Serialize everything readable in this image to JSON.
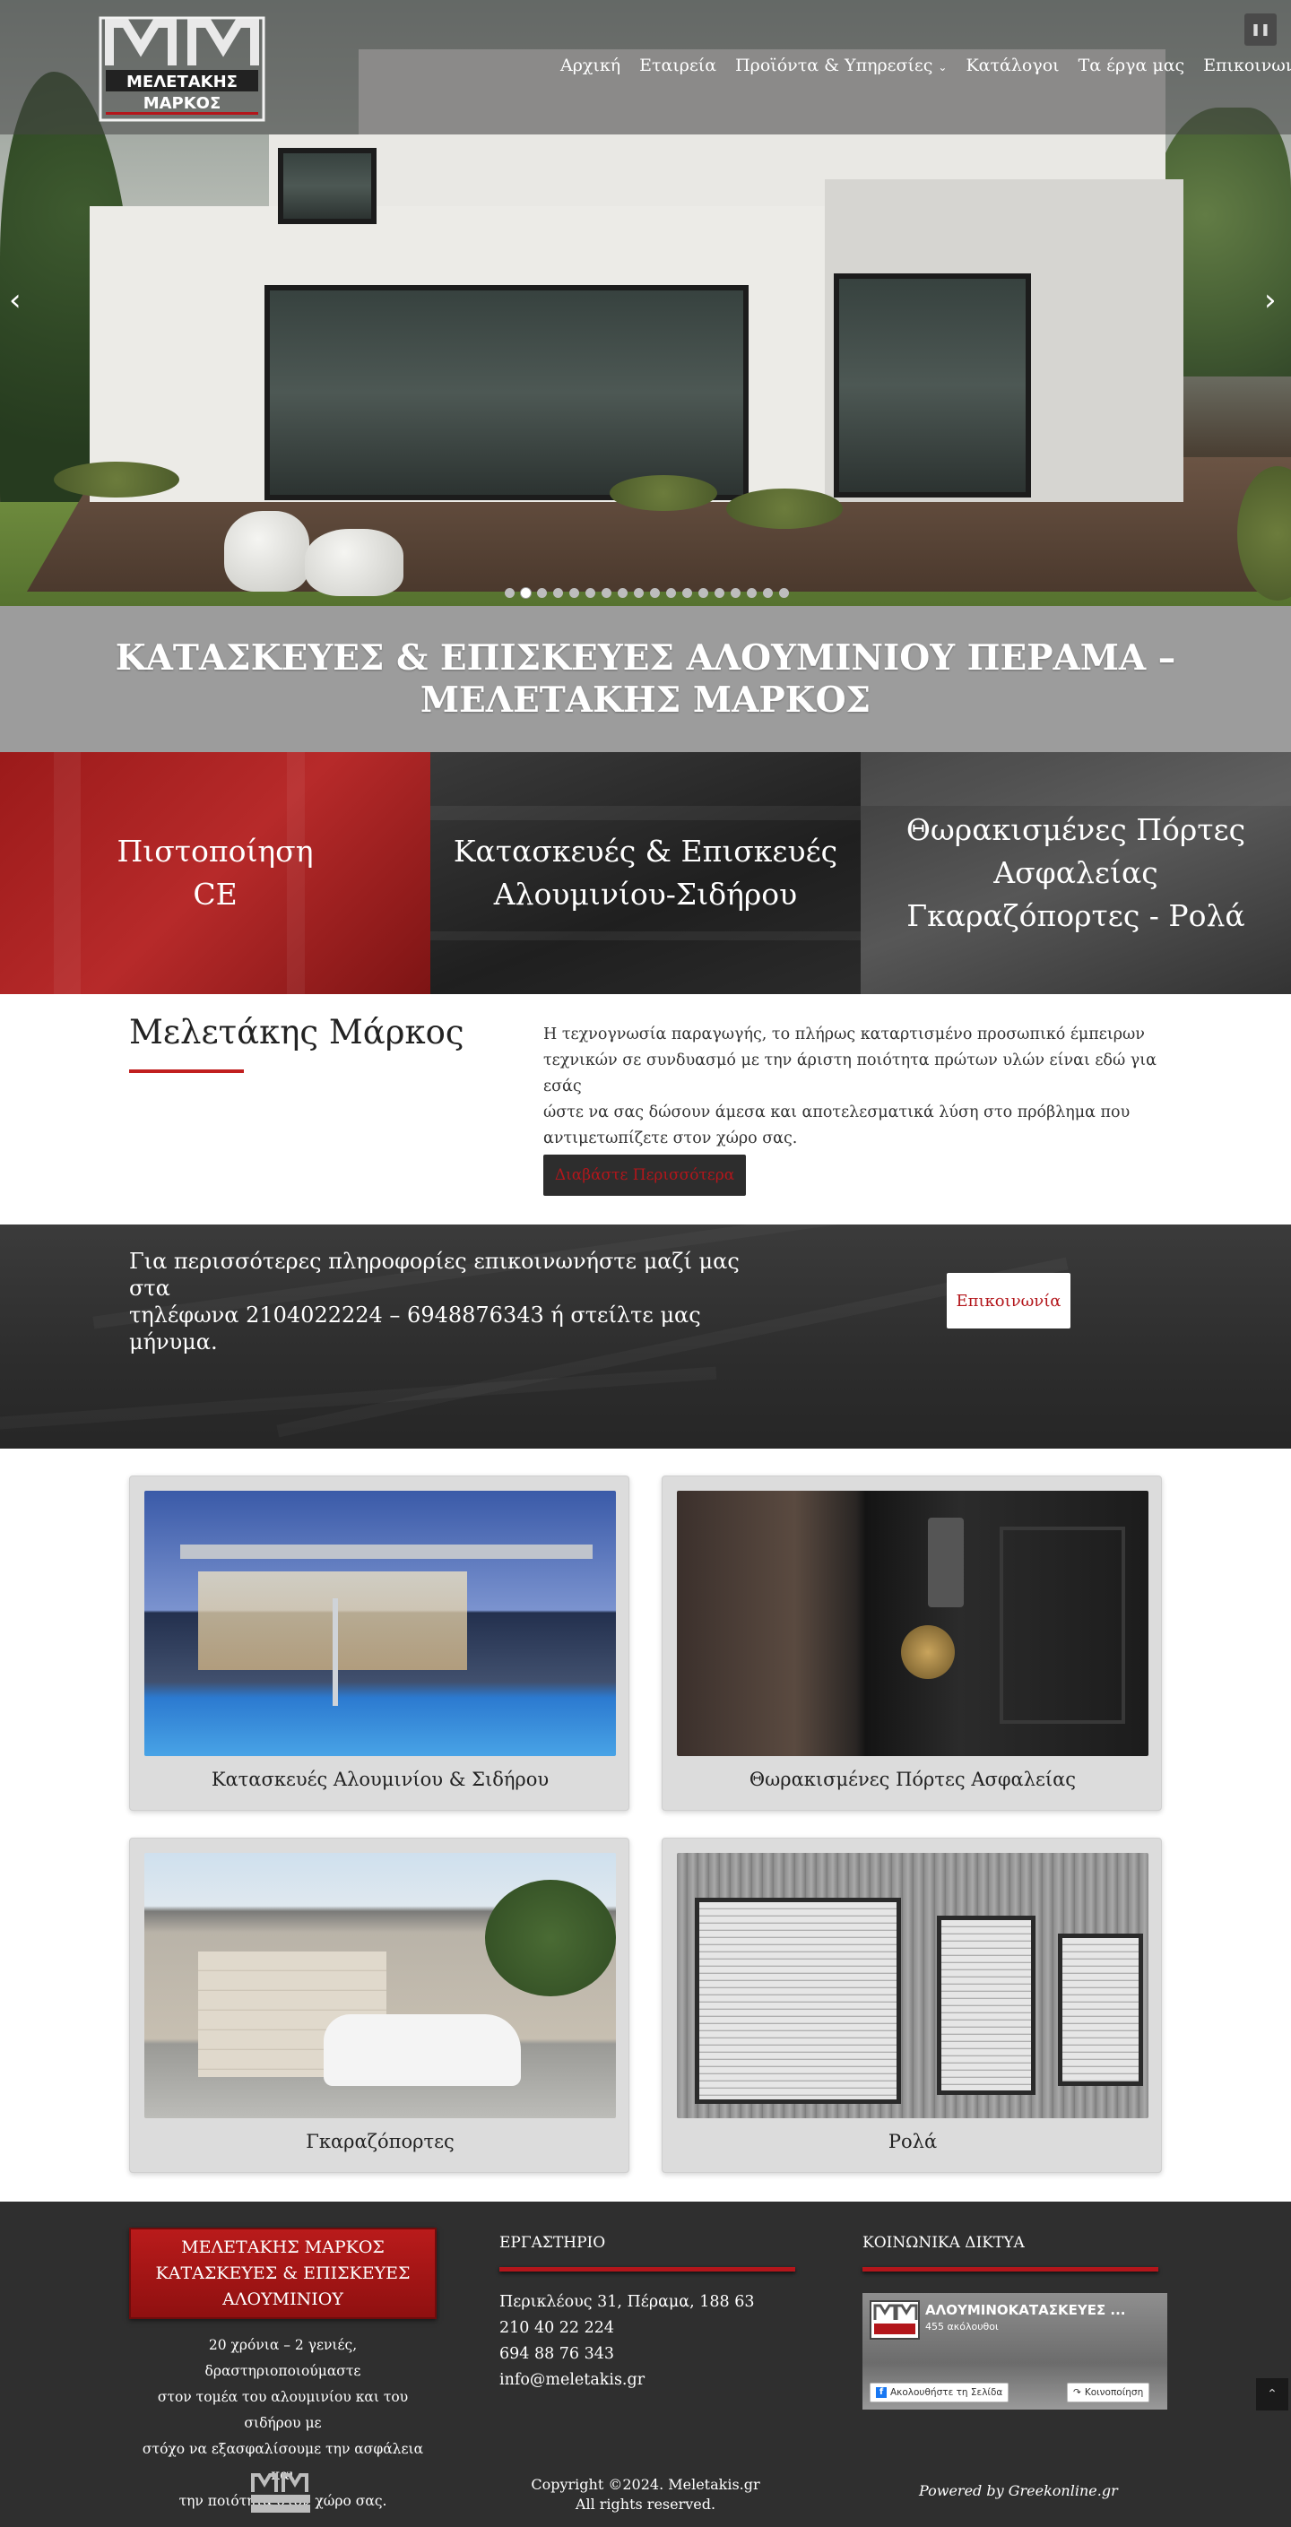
{
  "header": {
    "logo": {
      "line1": "ΜΕΛΕΤΑΚΗΣ",
      "line2": "ΜΑΡΚΟΣ"
    },
    "nav": [
      {
        "label": "Αρχική"
      },
      {
        "label": "Εταιρεία"
      },
      {
        "label": "Προϊόντα & Υπηρεσίες",
        "has_dropdown": true
      },
      {
        "label": "Κατάλογοι"
      },
      {
        "label": "Τα έργα μας"
      },
      {
        "label": "Επικοινωνία"
      }
    ],
    "pause_icon": "pause-icon"
  },
  "slider": {
    "slide_count": 18,
    "active_slide": 2,
    "prev_icon": "chevron-left-icon",
    "next_icon": "chevron-right-icon"
  },
  "title_band": {
    "title": "ΚΑΤΑΣΚΕΥΕΣ & ΕΠΙΣΚΕΥΕΣ ΑΛΟΥΜΙΝΙΟΥ ΠΕΡΑΜΑ – ΜΕΛΕΤΑΚΗΣ ΜΑΡΚΟΣ"
  },
  "features": [
    {
      "lines": [
        "Πιστοποίηση",
        "CE"
      ]
    },
    {
      "lines": [
        "Κατασκευές & Επισκευές",
        "Αλουμινίου-Σιδήρου"
      ]
    },
    {
      "lines": [
        "Θωρακισμένες Πόρτες",
        "Ασφαλείας",
        "Γκαραζόπορτες - Ρολά"
      ]
    }
  ],
  "about": {
    "heading": "Μελετάκης Μάρκος",
    "lines": [
      "Η τεχνογνωσία παραγωγής, το πλήρως καταρτισμένο προσωπικό έμπειρων",
      "τεχνικών σε συνδυασμό με την άριστη ποιότητα πρώτων υλών είναι εδώ για εσάς",
      "ώστε να σας δώσουν άμεσα και αποτελεσματικά λύση στο πρόβλημα που",
      "αντιμετωπίζετε στον χώρο σας."
    ],
    "button": "Διαβάστε Περισσότερα"
  },
  "contact_band": {
    "lines": [
      "Για περισσότερες πληροφορίες επικοινωνήστε μαζί μας στα",
      "τηλέφωνα 2104022224 – 6948876343 ή στείλτε μας μήνυμα."
    ],
    "button": "Επικοινωνία"
  },
  "products": [
    {
      "caption": "Κατασκευές Αλουμινίου & Σιδήρου"
    },
    {
      "caption": "Θωρακισμένες Πόρτες Ασφαλείας"
    },
    {
      "caption": "Γκαραζόπορτες"
    },
    {
      "caption": "Ρολά"
    }
  ],
  "footer": {
    "badge_lines": [
      "ΜΕΛΕΤΑΚΗΣ ΜΑΡΚΟΣ",
      "ΚΑΤΑΣΚΕΥΕΣ & ΕΠΙΣΚΕΥΕΣ",
      "ΑΛΟΥΜΙΝΙΟΥ"
    ],
    "about_lines": [
      "20 χρόνια – 2 γενιές, δραστηριοποιούμαστε",
      "στον τομέα του αλουμινίου και του σιδήρου με",
      "στόχο να εξασφαλίσουμε την ασφάλεια και",
      "την ποιότητα στον χώρο σας."
    ],
    "workshop_heading": "ΕΡΓΑΣΤΗΡΙΟ",
    "address": "Περικλέους 31, Πέραμα, 188 63",
    "phone1": "210 40 22 224",
    "phone2": "694 88 76 343",
    "email": "info@meletakis.gr",
    "social_heading": "ΚΟΙΝΩΝΙΚΑ ΔΙΚΤΥΑ",
    "facebook": {
      "page_name": "ΑΛΟΥΜΙΝΟΚΑΤΑΣΚΕΥΕΣ ...",
      "followers": "455 ακόλουθοι",
      "follow_label": "Ακολουθήστε τη Σελίδα",
      "share_label": "Κοινοποίηση"
    },
    "copyright_lines": [
      "Copyright ©2024. Meletakis.gr",
      "All rights reserved."
    ],
    "powered": "Powered by Greekonline.gr"
  },
  "colors": {
    "accent_red": "#b3161b",
    "dark_band": "#2f2f2f",
    "title_band_gray": "#9c9c9c"
  }
}
